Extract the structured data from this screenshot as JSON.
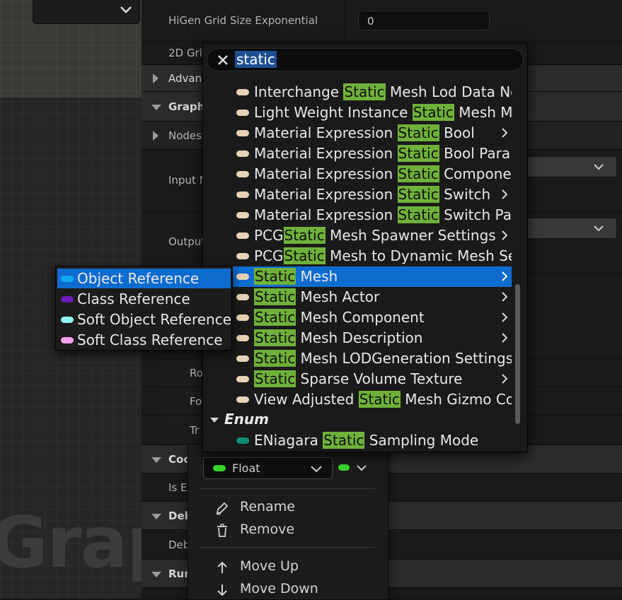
{
  "graph": {
    "watermark": "Graph"
  },
  "details": {
    "rows": {
      "higen_label": "HiGen Grid Size Exponential",
      "higen_value": "0",
      "grid2d_label": "2D Gri",
      "advanced_label": "Advan",
      "graph_label": "Graph",
      "nodes_label": "Nodes",
      "input_label": "Input N",
      "output_label": "Output",
      "ro_label": "Ro",
      "fo_label": "Fo",
      "tr_label": "Tr",
      "coo_label": "Coo",
      "ise_label": "Is E",
      "deb_label": "Deb",
      "debug_label": "Deb",
      "run_label": "Run"
    }
  },
  "search": {
    "query": "static",
    "results": [
      {
        "pre": "Interchange ",
        "hl": "Static",
        "post": " Mesh Lod Data No",
        "arrow": false
      },
      {
        "pre": "Light Weight Instance ",
        "hl": "Static",
        "post": " Mesh M",
        "arrow": false
      },
      {
        "pre": "Material Expression ",
        "hl": "Static",
        "post": " Bool",
        "arrow": true
      },
      {
        "pre": "Material Expression ",
        "hl": "Static",
        "post": " Bool Para",
        "arrow": false
      },
      {
        "pre": "Material Expression ",
        "hl": "Static",
        "post": " Compone",
        "arrow": false
      },
      {
        "pre": "Material Expression ",
        "hl": "Static",
        "post": " Switch",
        "arrow": true
      },
      {
        "pre": "Material Expression ",
        "hl": "Static",
        "post": " Switch Pa",
        "arrow": false
      },
      {
        "pre": "PCG",
        "hl": "Static",
        "post": " Mesh Spawner Settings",
        "arrow": true
      },
      {
        "pre": "PCG",
        "hl": "Static",
        "post": " Mesh to Dynamic Mesh Se",
        "arrow": false
      },
      {
        "pre": "",
        "hl": "Static",
        "post": " Mesh",
        "arrow": true,
        "selected": true
      },
      {
        "pre": "",
        "hl": "Static",
        "post": " Mesh Actor",
        "arrow": true
      },
      {
        "pre": "",
        "hl": "Static",
        "post": " Mesh Component",
        "arrow": true
      },
      {
        "pre": "",
        "hl": "Static",
        "post": " Mesh Description",
        "arrow": true
      },
      {
        "pre": "",
        "hl": "Static",
        "post": " Mesh LODGeneration Settings",
        "arrow": false
      },
      {
        "pre": "",
        "hl": "Static",
        "post": " Sparse Volume Texture",
        "arrow": true
      },
      {
        "pre": "View Adjusted ",
        "hl": "Static",
        "post": " Mesh Gizmo Co",
        "arrow": false
      }
    ],
    "enum_category": "Enum",
    "enum_result": {
      "pre": "ENiagara ",
      "hl": "Static",
      "post": " Sampling Mode"
    }
  },
  "ref_menu": {
    "items": [
      {
        "label": "Object Reference",
        "color": "#12a6ee",
        "selected": true
      },
      {
        "label": "Class Reference",
        "color": "#6a1bb7"
      },
      {
        "label": "Soft Object Reference",
        "color": "#8ef3f3"
      },
      {
        "label": "Soft Class Reference",
        "color": "#f4a2ee"
      }
    ]
  },
  "pin_menu": {
    "type_value": "Float",
    "rename": "Rename",
    "remove": "Remove",
    "move_up": "Move Up",
    "move_down": "Move Down"
  },
  "colors": {
    "float_pin": "#38d62c",
    "object_pin": "#e7d3b3",
    "enum_pin": "#0f8a74",
    "highlight": "#6fb13a",
    "selection": "#0f6ccf"
  }
}
